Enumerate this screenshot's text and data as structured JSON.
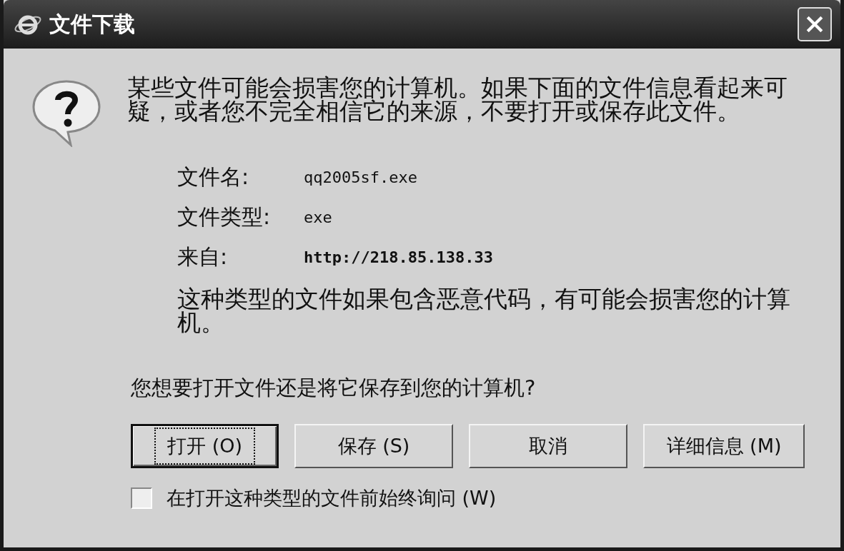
{
  "window": {
    "title": "文件下载"
  },
  "message": "某些文件可能会损害您的计算机。如果下面的文件信息看起来可疑，或者您不完全相信它的来源，不要打开或保存此文件。",
  "fields": [
    {
      "label": "文件名:",
      "value": "qq2005sf.exe"
    },
    {
      "label": "文件类型:",
      "value": "exe"
    },
    {
      "label": "来自:",
      "value": "http://218.85.138.33"
    }
  ],
  "warning": "这种类型的文件如果包含恶意代码，有可能会损害您的计算机。",
  "question": "您想要打开文件还是将它保存到您的计算机?",
  "buttons": [
    {
      "label": "打开 (O)",
      "focused": true
    },
    {
      "label": "保存 (S)",
      "focused": false
    },
    {
      "label": "取消",
      "focused": false
    },
    {
      "label": "详细信息 (M)",
      "focused": false
    }
  ],
  "checkbox": {
    "label": "在打开这种类型的文件前始终询问 (W)",
    "checked": false
  }
}
